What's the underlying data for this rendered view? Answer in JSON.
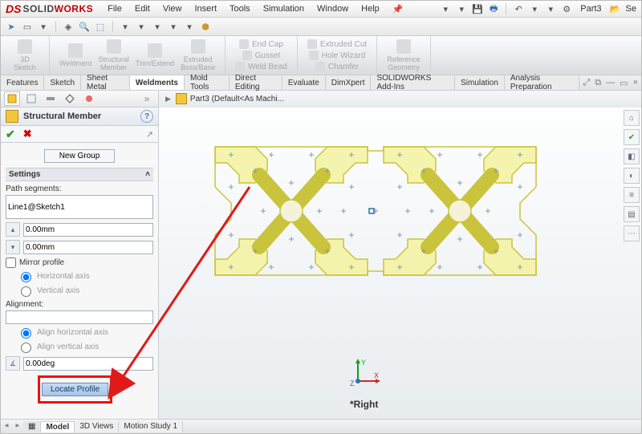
{
  "app": {
    "brand_ds": "DS",
    "brand_solid": "SOLID",
    "brand_works": "WORKS",
    "doc_name": "Part3",
    "search_placeholder": ""
  },
  "menu": {
    "items": [
      "File",
      "Edit",
      "View",
      "Insert",
      "Tools",
      "Simulation",
      "Window",
      "Help"
    ]
  },
  "ribbon": {
    "large": [
      {
        "label": "3D\nSketch"
      },
      {
        "label": "Weldment"
      },
      {
        "label": "Structural\nMember"
      },
      {
        "label": "Trim/Extend"
      },
      {
        "label": "Extruded\nBoss/Base"
      }
    ],
    "col1": [
      "End Cap",
      "Gusset",
      "Weld Bead"
    ],
    "col2": [
      "Extruded Cut",
      "Hole Wizard",
      "Chamfer"
    ],
    "ref": "Reference\nGeometry"
  },
  "ribbon_tabs": [
    "Features",
    "Sketch",
    "Sheet Metal",
    "Weldments",
    "Mold Tools",
    "Direct Editing",
    "Evaluate",
    "DimXpert",
    "SOLIDWORKS Add-Ins",
    "Simulation",
    "Analysis Preparation"
  ],
  "ribbon_tab_selected": 3,
  "doc_crumb": "Part3  (Default<As Machi...",
  "panel": {
    "title": "Structural Member",
    "new_group": "New Group",
    "settings_header": "Settings",
    "path_label": "Path segments:",
    "path_value": "Line1@Sketch1",
    "dim1": "0.00mm",
    "dim2": "0.00mm",
    "mirror_label": "Mirror profile",
    "mirror_h": "Horizontal axis",
    "mirror_v": "Vertical axis",
    "align_label": "Alignment:",
    "align_value": "",
    "align_h": "Align horizontal axis",
    "align_v": "Align vertical axis",
    "angle": "0.00deg",
    "locate": "Locate Profile"
  },
  "status_view": "*Right",
  "bottom_tabs": [
    "Model",
    "3D Views",
    "Motion Study 1"
  ],
  "bottom_tab_selected": 0,
  "triad": {
    "x": "X",
    "y": "Y",
    "z": "Z"
  },
  "colors": {
    "profile_fill": "#f4f29a",
    "profile_stroke": "#c9c43c",
    "annotation": "#e11919"
  }
}
